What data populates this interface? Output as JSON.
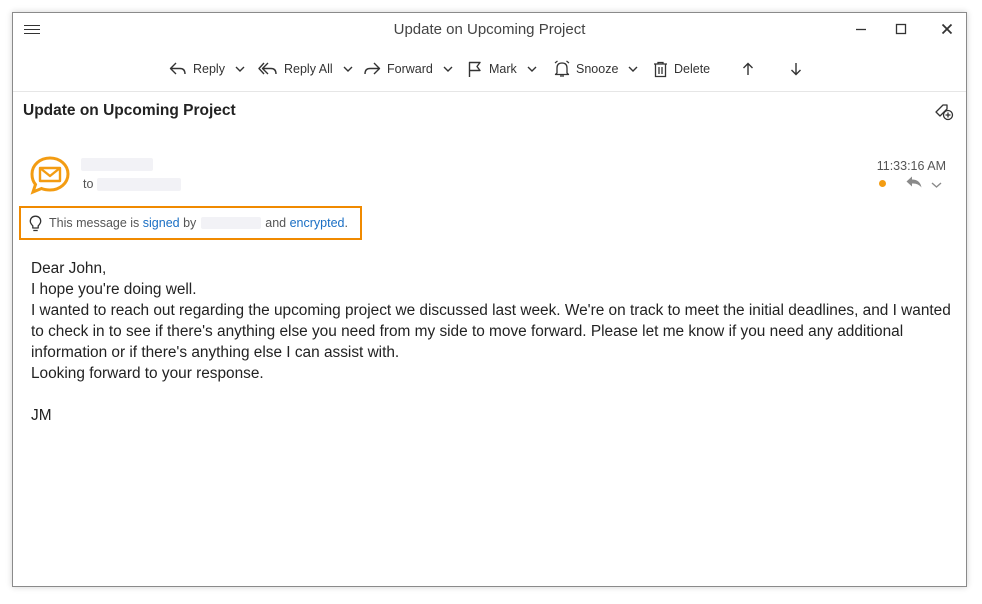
{
  "window": {
    "title": "Update on Upcoming Project"
  },
  "toolbar": {
    "reply_label": "Reply",
    "reply_all_label": "Reply All",
    "forward_label": "Forward",
    "mark_label": "Mark",
    "snooze_label": "Snooze",
    "delete_label": "Delete"
  },
  "message": {
    "subject": "Update on Upcoming Project",
    "to_prefix": "to",
    "timestamp": "11:33:16 AM",
    "security": {
      "prefix": "This message is ",
      "signed_link": "signed",
      "by": " by ",
      "and": " and ",
      "encrypted_link": "encrypted",
      "suffix": "."
    },
    "body": {
      "greeting": "Dear John,",
      "line1": "I hope you're doing well.",
      "line2": "I wanted to reach out regarding the upcoming project we discussed last week. We're on track to meet the initial deadlines, and I wanted to check in to see if there's anything else you need from my side to move forward. Please let me know if you need any additional information or if there's anything else I can assist with.",
      "line3": "Looking forward to your response.",
      "signature": "JM"
    }
  },
  "colors": {
    "accent_orange": "#f39c12",
    "highlight_border": "#f08a00",
    "link_blue": "#1a6fc4"
  },
  "icons": {
    "menu": "hamburger-icon",
    "minimize": "minimize-icon",
    "maximize": "maximize-icon",
    "close": "close-icon",
    "reply": "reply-icon",
    "reply_all": "reply-all-icon",
    "forward": "forward-icon",
    "mark": "flag-icon",
    "snooze": "bell-icon",
    "delete": "trash-icon",
    "prev": "arrow-up-icon",
    "next": "arrow-down-icon",
    "tag": "tag-add-icon",
    "avatar": "mail-bubble-icon",
    "security": "lightbulb-icon"
  }
}
